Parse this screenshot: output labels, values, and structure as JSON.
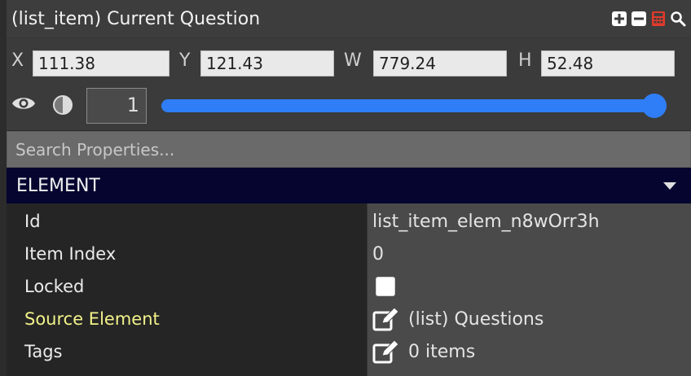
{
  "header": {
    "title": "(list_item) Current Question",
    "icons": [
      "add-icon",
      "remove-icon",
      "calculator-icon",
      "search-icon"
    ],
    "accent_red": "#e23a2b"
  },
  "coords": {
    "x_label": "X",
    "x_value": "111.38",
    "y_label": "Y",
    "y_value": "121.43",
    "w_label": "W",
    "w_value": "779.24",
    "h_label": "H",
    "h_value": "52.48"
  },
  "opacity": {
    "value": "1",
    "slider_fraction": 1.0,
    "slider_color": "#2f7ef7"
  },
  "search": {
    "placeholder": "Search Properties..."
  },
  "section": {
    "title": "ELEMENT",
    "bg_color": "#050530"
  },
  "properties": [
    {
      "label": "Id",
      "value": "list_item_elem_n8wOrr3h"
    },
    {
      "label": "Item Index",
      "value": "0"
    },
    {
      "label": "Locked",
      "value": ""
    },
    {
      "label": "Source Element",
      "value": "(list) Questions"
    },
    {
      "label": "Tags",
      "value": "0 items"
    }
  ],
  "highlight_color": "#f2f28a"
}
